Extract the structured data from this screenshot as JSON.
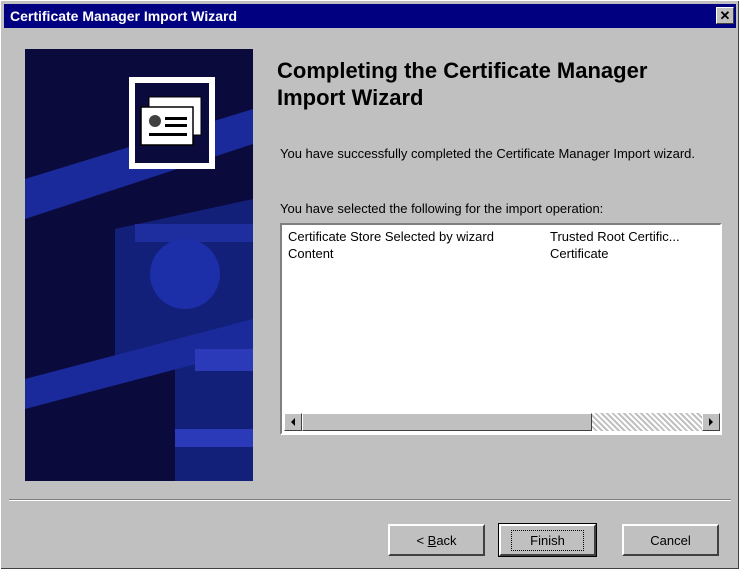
{
  "window": {
    "title": "Certificate Manager Import Wizard",
    "close_glyph": "✕"
  },
  "main": {
    "heading": "Completing the Certificate Manager Import Wizard",
    "message_completed": "You have successfully completed the Certificate Manager Import wizard.",
    "message_selected": "You have selected the following for the import operation:",
    "summary": {
      "rows": [
        {
          "setting": "Certificate Store Selected by wizard",
          "value": "Trusted Root Certific..."
        },
        {
          "setting": "Content",
          "value": "Certificate"
        }
      ]
    }
  },
  "footer": {
    "back_prefix": "< ",
    "back_mnemonic": "B",
    "back_rest": "ack",
    "finish_label": "Finish",
    "cancel_label": "Cancel"
  },
  "colors": {
    "titlebar": "#000080",
    "banner": "#0a0a3c",
    "face": "#c0c0c0"
  },
  "icons": {
    "wizard": "certificate-icon",
    "scroll_left": "arrow-left-icon",
    "scroll_right": "arrow-right-icon"
  }
}
